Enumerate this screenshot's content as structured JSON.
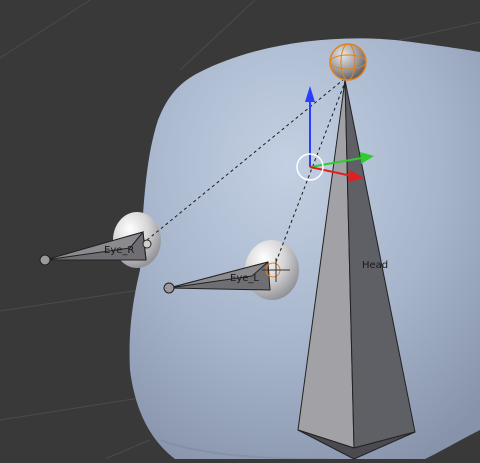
{
  "viewport": {
    "background_color": "#393939",
    "grid_color": "#4a4a4a"
  },
  "scene": {
    "head_mesh_color": "#a7b5cc",
    "bone_color": "#7b7b7e",
    "bone_selected_outline": "#e3801e",
    "eye_sphere_color": "#dcdcdc",
    "relationship_line_color": "#1a1a1a"
  },
  "bones": {
    "eye_r_label": "Eye_R",
    "eye_l_label": "Eye_L",
    "head_label": "Head"
  },
  "gizmo": {
    "z_axis_color": "#2a3cff",
    "y_axis_color": "#2ecc2e",
    "x_axis_color": "#e02020",
    "center_icon": "3d-cursor-icon"
  }
}
